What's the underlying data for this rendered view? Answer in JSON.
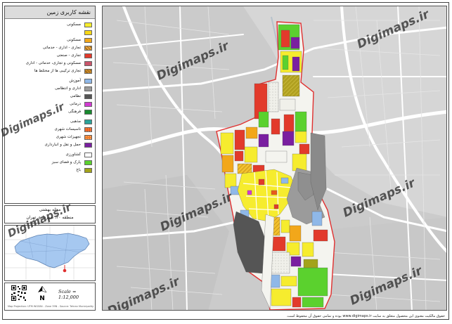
{
  "legend": {
    "title": "نقشه کاربری زمین",
    "items": [
      {
        "label": "مسکونی",
        "color": "#f6ec2e",
        "gap": false
      },
      {
        "label": "",
        "color": "#f7d716",
        "gap": false
      },
      {
        "label": "مسکونی",
        "color": "#f2a71a",
        "gap": false
      },
      {
        "label": "تجاری - اداری - خدماتی",
        "color": "#e8a23c",
        "gap": false
      },
      {
        "label": "تجاری - صنعتی",
        "color": "#e23a2b",
        "gap": false
      },
      {
        "label": "مسکونی و تجاری، خدماتی - اداری",
        "color": "#c9556b",
        "gap": false
      },
      {
        "label": "تجاری ترکیبی ها از مختلط ها",
        "color": "#c98a2c",
        "gap": false
      },
      {
        "label": "آموزش",
        "color": "#8fb8e8",
        "gap": true
      },
      {
        "label": "اداری و انتظامی",
        "color": "#9b9b9b",
        "gap": false
      },
      {
        "label": "نظامی",
        "color": "#555555",
        "gap": false
      },
      {
        "label": "درمانی",
        "color": "#d13bd1",
        "gap": false
      },
      {
        "label": "فرهنگی",
        "color": "#178a2e",
        "gap": false
      },
      {
        "label": "مذهبی",
        "color": "#2aa39a",
        "gap": true
      },
      {
        "label": "تاسیسات شهری",
        "color": "#e85a1a",
        "gap": false
      },
      {
        "label": "تجهیزات شهری",
        "color": "#f07d2a",
        "gap": false
      },
      {
        "label": "حمل و نقل و انبارداری",
        "color": "#7a1fa0",
        "gap": false
      },
      {
        "label": "کشاورزی",
        "color": "#ffffff",
        "gap": true
      },
      {
        "label": "پارک و فضای سبز",
        "color": "#5bd12e",
        "gap": false
      },
      {
        "label": "باغ",
        "color": "#a3a31a",
        "gap": false
      }
    ]
  },
  "info": {
    "line1": "محله بهشتی",
    "line2": "منطقه ۲۰، شهرداری تهران"
  },
  "scale_text": "Scale = 1:12,000",
  "north_label": "N",
  "credit_text": "Map Projection: UTM WGS84 - Zone 39N - Source: Tehran Municipality",
  "footer_note": "حقوق مالکیت معنوی این محصول متعلق به سایت www.digimaps.ir بوده و تمامی حقوق آن محفوظ است.",
  "watermark": "Digimaps.ir",
  "colors": {
    "residential": "#f6ec2e",
    "commercial": "#e23a2b",
    "military": "#555555",
    "park": "#5bd12e",
    "transport": "#7a1fa0",
    "education": "#8fb8e8",
    "boundary": "#e03030"
  }
}
